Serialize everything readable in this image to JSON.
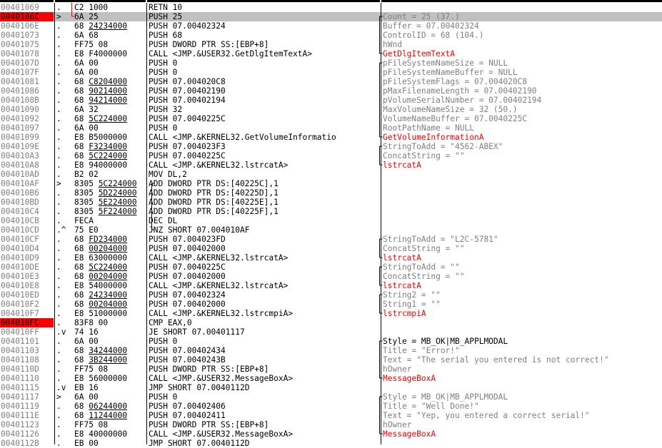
{
  "rows": [
    {
      "addr": "00401069",
      "mark": ".",
      "hex": "C2 1000",
      "dis": "RETN 10",
      "cmt": "",
      "ct": ""
    },
    {
      "addr": "0040106C",
      "mark": ">",
      "hex": "6A 25",
      "dis": "PUSH 25",
      "cmt": "Count = 25 (37.)",
      "ct": "cl",
      "cur": true
    },
    {
      "addr": "0040106E",
      "mark": ".",
      "hex": "68 24234000",
      "dis": "PUSH 07.00402324",
      "cmt": "Buffer = 07.00402324",
      "ct": "cl"
    },
    {
      "addr": "00401073",
      "mark": ".",
      "hex": "6A 68",
      "dis": "PUSH 68",
      "cmt": "ControlID = 68 (104.)",
      "ct": "cl"
    },
    {
      "addr": "00401075",
      "mark": ".",
      "hex": "FF75 08",
      "dis": "PUSH DWORD PTR SS:[EBP+8]",
      "cmt": "hWnd",
      "ct": "cl"
    },
    {
      "addr": "00401078",
      "mark": ".",
      "hex": "E8 F4000000",
      "dis": "CALL <JMP.&USER32.GetDlgItemTextA>",
      "cmt": "GetDlgItemTextA",
      "ct": "fn"
    },
    {
      "addr": "0040107D",
      "mark": ".",
      "hex": "6A 00",
      "dis": "PUSH 0",
      "cmt": "pFileSystemNameSize = NULL",
      "ct": "cl"
    },
    {
      "addr": "0040107F",
      "mark": ".",
      "hex": "6A 00",
      "dis": "PUSH 0",
      "cmt": "pFileSystemNameBuffer = NULL",
      "ct": "cl"
    },
    {
      "addr": "00401081",
      "mark": ".",
      "hex": "68 C8204000",
      "dis": "PUSH 07.004020C8",
      "cmt": "pFileSystemFlags = 07.004020C8",
      "ct": "cl"
    },
    {
      "addr": "00401086",
      "mark": ".",
      "hex": "68 90214000",
      "dis": "PUSH 07.00402190",
      "cmt": "pMaxFilenameLength = 07.00402190",
      "ct": "cl"
    },
    {
      "addr": "0040108B",
      "mark": ".",
      "hex": "68 94214000",
      "dis": "PUSH 07.00402194",
      "cmt": "pVolumeSerialNumber = 07.00402194",
      "ct": "cl"
    },
    {
      "addr": "00401090",
      "mark": ".",
      "hex": "6A 32",
      "dis": "PUSH 32",
      "cmt": "MaxVolumeNameSize = 32 (50.)",
      "ct": "cl"
    },
    {
      "addr": "00401092",
      "mark": ".",
      "hex": "68 5C224000",
      "dis": "PUSH 07.0040225C",
      "cmt": "VolumeNameBuffer = 07.0040225C",
      "ct": "cl"
    },
    {
      "addr": "00401097",
      "mark": ".",
      "hex": "6A 00",
      "dis": "PUSH 0",
      "cmt": "RootPathName = NULL",
      "ct": "cl"
    },
    {
      "addr": "00401099",
      "mark": ".",
      "hex": "E8 B5000000",
      "dis": "CALL <JMP.&KERNEL32.GetVolumeInformatio",
      "cmt": "GetVolumeInformationA",
      "ct": "fn"
    },
    {
      "addr": "0040109E",
      "mark": ".",
      "hex": "68 F3234000",
      "dis": "PUSH 07.004023F3",
      "cmt": "StringToAdd = \"4562-ABEX\"",
      "ct": "cl"
    },
    {
      "addr": "004010A3",
      "mark": ".",
      "hex": "68 5C224000",
      "dis": "PUSH 07.0040225C",
      "cmt": "ConcatString = \"\"",
      "ct": "cl"
    },
    {
      "addr": "004010A8",
      "mark": ".",
      "hex": "E8 94000000",
      "dis": "CALL <JMP.&KERNEL32.lstrcatA>",
      "cmt": "lstrcatA",
      "ct": "fn"
    },
    {
      "addr": "004010AD",
      "mark": ".",
      "hex": "B2 02",
      "dis": "MOV DL,2",
      "cmt": "",
      "ct": ""
    },
    {
      "addr": "004010AF",
      "mark": ">",
      "hex": "8305 5C224000",
      "dis": "ADD DWORD PTR DS:[40225C],1",
      "cmt": "",
      "ct": ""
    },
    {
      "addr": "004010B6",
      "mark": ".",
      "hex": "8305 5D224000",
      "dis": "ADD DWORD PTR DS:[40225D],1",
      "cmt": "",
      "ct": ""
    },
    {
      "addr": "004010BD",
      "mark": ".",
      "hex": "8305 5E224000",
      "dis": "ADD DWORD PTR DS:[40225E],1",
      "cmt": "",
      "ct": ""
    },
    {
      "addr": "004010C4",
      "mark": ".",
      "hex": "8305 5F224000",
      "dis": "ADD DWORD PTR DS:[40225F],1",
      "cmt": "",
      "ct": ""
    },
    {
      "addr": "004010CB",
      "mark": ".",
      "hex": "FECA",
      "dis": "DEC DL",
      "cmt": "",
      "ct": ""
    },
    {
      "addr": "004010CD",
      "mark": ".^",
      "hex": "75 E0",
      "dis": "JNZ SHORT 07.004010AF",
      "cmt": "",
      "ct": ""
    },
    {
      "addr": "004010CF",
      "mark": ".",
      "hex": "68 FD234000",
      "dis": "PUSH 07.004023FD",
      "cmt": "StringToAdd = \"L2C-5781\"",
      "ct": "cl"
    },
    {
      "addr": "004010D4",
      "mark": ".",
      "hex": "68 00204000",
      "dis": "PUSH 07.00402000",
      "cmt": "ConcatString = \"\"",
      "ct": "cl"
    },
    {
      "addr": "004010D9",
      "mark": ".",
      "hex": "E8 63000000",
      "dis": "CALL <JMP.&KERNEL32.lstrcatA>",
      "cmt": "lstrcatA",
      "ct": "fn"
    },
    {
      "addr": "004010DE",
      "mark": ".",
      "hex": "68 5C224000",
      "dis": "PUSH 07.0040225C",
      "cmt": "StringToAdd = \"\"",
      "ct": "cl"
    },
    {
      "addr": "004010E3",
      "mark": ".",
      "hex": "68 00204000",
      "dis": "PUSH 07.00402000",
      "cmt": "ConcatString = \"\"",
      "ct": "cl"
    },
    {
      "addr": "004010E8",
      "mark": ".",
      "hex": "E8 54000000",
      "dis": "CALL <JMP.&KERNEL32.lstrcatA>",
      "cmt": "lstrcatA",
      "ct": "fn"
    },
    {
      "addr": "004010ED",
      "mark": ".",
      "hex": "68 24234000",
      "dis": "PUSH 07.00402324",
      "cmt": "String2 = \"\"",
      "ct": "cl"
    },
    {
      "addr": "004010F2",
      "mark": ".",
      "hex": "68 00204000",
      "dis": "PUSH 07.00402000",
      "cmt": "String1 = \"\"",
      "ct": "cl"
    },
    {
      "addr": "004010F7",
      "mark": ".",
      "hex": "E8 51000000",
      "dis": "CALL <JMP.&KERNEL32.lstrcmpiA>",
      "cmt": "lstrcmpiA",
      "ct": "fn"
    },
    {
      "addr": "004010FC",
      "mark": ".",
      "hex": "83F8 00",
      "dis": "CMP EAX,0",
      "cmt": "",
      "ct": "",
      "hl": true
    },
    {
      "addr": "004010FF",
      "mark": ".v",
      "hex": "74 16",
      "dis": "JE SHORT 07.00401117",
      "cmt": "",
      "ct": ""
    },
    {
      "addr": "00401101",
      "mark": ".",
      "hex": "6A 00",
      "dis": "PUSH 0",
      "cmt": "Style = MB_OK|MB_APPLMODAL",
      "ct": ""
    },
    {
      "addr": "00401103",
      "mark": ".",
      "hex": "68 34244000",
      "dis": "PUSH 07.00402434",
      "cmt": "Title = \"Error!\"",
      "ct": "cl"
    },
    {
      "addr": "00401108",
      "mark": ".",
      "hex": "68 3B244000",
      "dis": "PUSH 07.0040243B",
      "cmt": "Text = \"The serial you entered is not correct!\"",
      "ct": "cl"
    },
    {
      "addr": "0040110D",
      "mark": ".",
      "hex": "FF75 08",
      "dis": "PUSH DWORD PTR SS:[EBP+8]",
      "cmt": "hOwner",
      "ct": "cl"
    },
    {
      "addr": "00401110",
      "mark": ".",
      "hex": "E8 56000000",
      "dis": "CALL <JMP.&USER32.MessageBoxA>",
      "cmt": "MessageBoxA",
      "ct": "fn"
    },
    {
      "addr": "00401115",
      "mark": ".v",
      "hex": "EB 16",
      "dis": "JMP SHORT 07.0040112D",
      "cmt": "",
      "ct": ""
    },
    {
      "addr": "00401117",
      "mark": ">",
      "hex": "6A 00",
      "dis": "PUSH 0",
      "cmt": "Style = MB_OK|MB_APPLMODAL",
      "ct": "cl"
    },
    {
      "addr": "00401119",
      "mark": ".",
      "hex": "68 06244000",
      "dis": "PUSH 07.00402406",
      "cmt": "Title = \"Well Done!\"",
      "ct": "cl"
    },
    {
      "addr": "0040111E",
      "mark": ".",
      "hex": "68 11244000",
      "dis": "PUSH 07.00402411",
      "cmt": "Text = \"Yep, you entered a correct serial!\"",
      "ct": "cl"
    },
    {
      "addr": "00401123",
      "mark": ".",
      "hex": "FF75 08",
      "dis": "PUSH DWORD PTR SS:[EBP+8]",
      "cmt": "hOwner",
      "ct": "cl"
    },
    {
      "addr": "00401126",
      "mark": ".",
      "hex": "E8 40000000",
      "dis": "CALL <JMP.&USER32.MessageBoxA>",
      "cmt": "MessageBoxA",
      "ct": "fn"
    },
    {
      "addr": "0040112B",
      "mark": ".",
      "hex": "EB 00",
      "dis": "JMP SHORT 07.0040112D",
      "cmt": "",
      "ct": ""
    }
  ],
  "colors": {
    "current_line": "#c0c0c0",
    "address_highlight": "#ff0000",
    "function_name": "#ff0000",
    "comment_gray": "#808080",
    "address_gray": "#808080"
  }
}
